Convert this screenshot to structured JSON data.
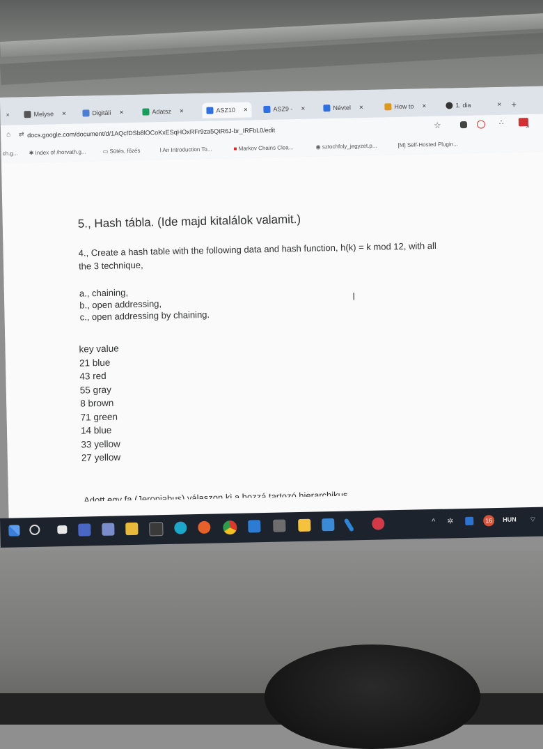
{
  "browser": {
    "tabs": [
      {
        "label": "Melyse",
        "close": "×",
        "color": "#555"
      },
      {
        "label": "Digitáli",
        "close": "×",
        "color": "#4a7fd4"
      },
      {
        "label": "Adatsz",
        "close": "×",
        "color": "#1a9c5c"
      },
      {
        "label": "ASZ10",
        "close": "×",
        "color": "#2f6fe0"
      },
      {
        "label": "ASZ9 -",
        "close": "×",
        "color": "#2f6fe0"
      },
      {
        "label": "Névtel",
        "close": "×",
        "color": "#2f6fe0"
      },
      {
        "label": "How to",
        "close": "×",
        "color": "#d99a1e"
      },
      {
        "label": "1. dia",
        "close": "×",
        "color": "#333"
      }
    ],
    "first_close": "×",
    "new_tab": "+",
    "url": "docs.google.com/document/d/1AQcfDSb8lOCoKxESqHOxRFr9za5QtR6J-br_IRFbL0/edit",
    "extensions_more": "»",
    "bookmarks": [
      {
        "label": "ch.g..."
      },
      {
        "label": "Index of /horvath.g..."
      },
      {
        "label": "Sütés, főzés"
      },
      {
        "label": "An Introduction To..."
      },
      {
        "label": "Markov Chains Clea..."
      },
      {
        "label": "sztochfoly_jegyzet.p..."
      },
      {
        "label": "[M] Self-Hosted Plugin..."
      }
    ]
  },
  "document": {
    "heading": "5., Hash tábla. (Ide majd kitalálok valamit.)",
    "task_line1": "4., Create a hash table with the following data and hash function, h(k) = k mod 12, with all",
    "task_line2": "the 3 technique,",
    "options": [
      "a., chaining,",
      "b., open addressing,",
      "c., open addressing by chaining."
    ],
    "table_header": "key value",
    "rows": [
      "21 blue",
      "43 red",
      "55 gray",
      "8 brown",
      "71 green",
      "14 blue",
      "33 yellow",
      "27 yellow"
    ],
    "cursor": "I",
    "cut_off_line": "Adott egy fa (Jeroniabus) válaszon ki a hozzá tartozó hierarchikus"
  },
  "taskbar": {
    "badge": "16",
    "language": "HUN",
    "chevron": "^"
  },
  "colors": {
    "doc_text": "#2f3030",
    "taskbar_bg": "#1c232c",
    "tab_bar_bg": "#dee3ea"
  }
}
